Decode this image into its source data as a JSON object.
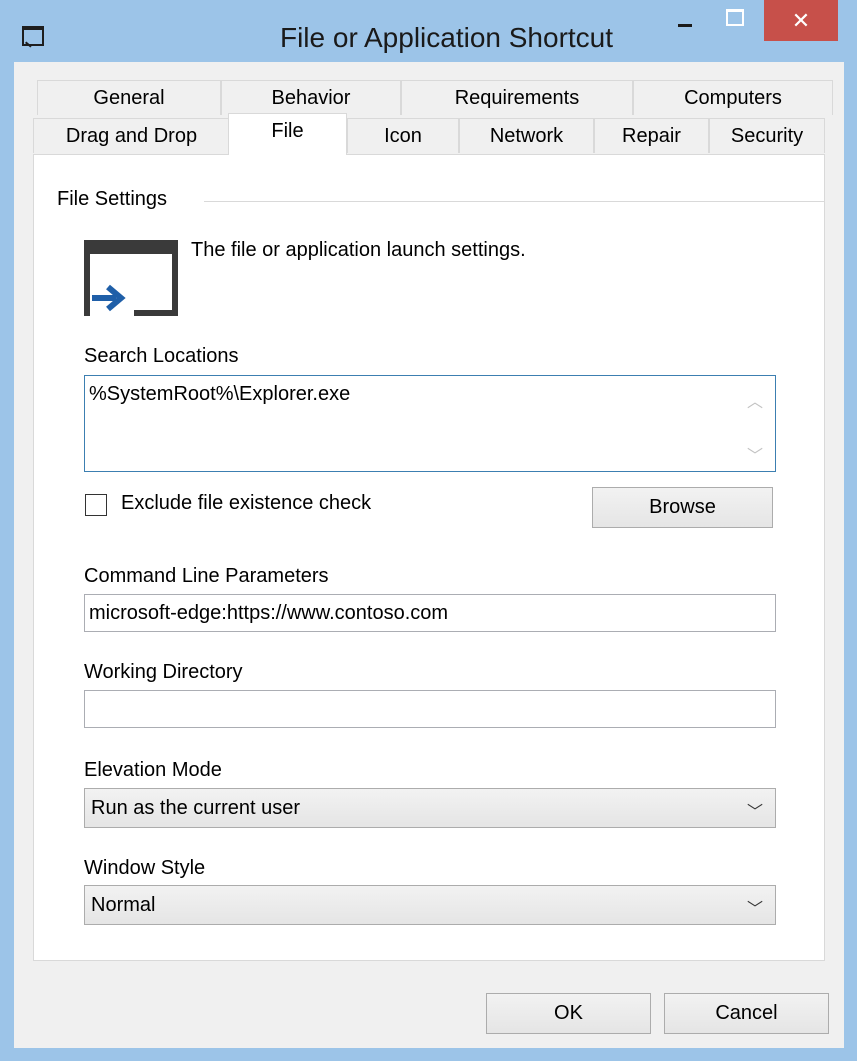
{
  "window": {
    "title": "File or Application Shortcut",
    "close_glyph": "✕"
  },
  "tabs": {
    "row1": [
      "General",
      "Behavior",
      "Requirements",
      "Computers"
    ],
    "row2": [
      "Drag and Drop",
      "File",
      "Icon",
      "Network",
      "Repair",
      "Security"
    ],
    "active": "File"
  },
  "panel": {
    "section_title": "File Settings",
    "description": "The file or application launch settings.",
    "icon": "shortcut-arrow-icon",
    "search_locations": {
      "label": "Search Locations",
      "value": "%SystemRoot%\\Explorer.exe"
    },
    "exclude_check": {
      "label": "Exclude file existence check",
      "checked": false
    },
    "browse_label": "Browse",
    "command_line": {
      "label": "Command Line Parameters",
      "value": "microsoft-edge:https://www.contoso.com"
    },
    "working_directory": {
      "label": "Working Directory",
      "value": ""
    },
    "elevation_mode": {
      "label": "Elevation Mode",
      "selected": "Run as the current user"
    },
    "window_style": {
      "label": "Window Style",
      "selected": "Normal"
    }
  },
  "footer": {
    "ok_label": "OK",
    "cancel_label": "Cancel"
  },
  "colors": {
    "titlebar": "#9cc4e8",
    "close_button": "#c7504a",
    "focus_border": "#3c7fb1",
    "icon_arrow": "#1f5fa8"
  }
}
